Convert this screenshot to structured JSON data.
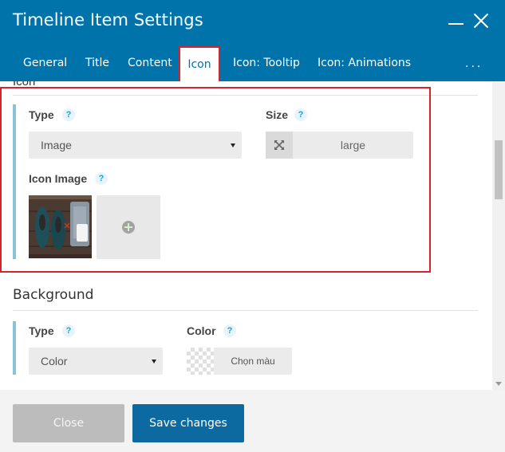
{
  "window": {
    "title": "Timeline Item Settings"
  },
  "tabs": [
    {
      "label": "General"
    },
    {
      "label": "Title"
    },
    {
      "label": "Content"
    },
    {
      "label": "Icon",
      "active": true
    },
    {
      "label": "Icon: Tooltip"
    },
    {
      "label": "Icon: Animations"
    }
  ],
  "more_menu": "...",
  "icon_section": {
    "heading": "Icon",
    "type": {
      "label": "Type",
      "value": "Image"
    },
    "size": {
      "label": "Size",
      "icon": "expand-icon",
      "value": "large"
    },
    "icon_image": {
      "label": "Icon Image",
      "add_icon": "plus-icon"
    }
  },
  "background_section": {
    "heading": "Background",
    "type": {
      "label": "Type",
      "value": "Color"
    },
    "color": {
      "label": "Color",
      "button_text": "Chọn màu"
    }
  },
  "help_glyph": "?",
  "footer": {
    "close_label": "Close",
    "save_label": "Save changes"
  },
  "colors": {
    "header": "#0073aa",
    "highlight": "#d5242d",
    "group_bar": "#89c4d6",
    "save_button": "#0d6aa1",
    "close_button": "#bcbcbc"
  }
}
